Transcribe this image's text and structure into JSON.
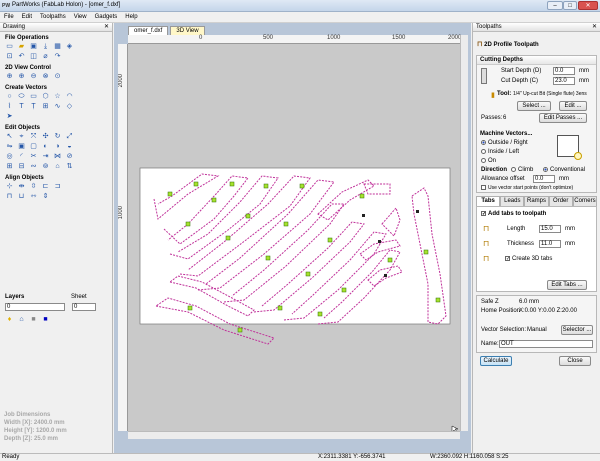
{
  "window": {
    "title": "PartWorks (FabLab Holon) - [omer_f.dxf]",
    "logo": "PW",
    "min": "–",
    "max": "□",
    "close": "✕"
  },
  "menu": [
    "File",
    "Edit",
    "Toolpaths",
    "View",
    "Gadgets",
    "Help"
  ],
  "left_panel": {
    "title": "Drawing",
    "close": "✕",
    "sections": {
      "file_ops": "File Operations",
      "view_ctrl": "2D View Control",
      "create_vectors": "Create Vectors",
      "edit_objects": "Edit Objects",
      "align_objects": "Align Objects"
    },
    "layers_label": "Layers",
    "layer_value": "0",
    "sheet_label": "Sheet",
    "sheet_value": "0",
    "job_dimensions": {
      "heading": "Job Dimensions",
      "width": "Width  [X]: 2400.0 mm",
      "height": "Height [Y]: 1200.0 mm",
      "depth": "Depth  [Z]: 25.0 mm"
    }
  },
  "canvas": {
    "tabs": [
      "omer_f.dxf",
      "3D View"
    ],
    "ruler_top": [
      "0",
      "500",
      "1000",
      "1500",
      "2000"
    ],
    "ruler_left": [
      "2000",
      "1000"
    ]
  },
  "right_panel": {
    "title": "Toolpaths",
    "close": "✕",
    "header": "2D Profile Toolpath",
    "cutting_depths": {
      "title": "Cutting Depths",
      "start_label": "Start Depth (D)",
      "start_value": "0.0",
      "cut_label": "Cut Depth (C)",
      "cut_value": "23.0",
      "unit": "mm"
    },
    "tool": {
      "label": "Tool:",
      "value": "1/4\" Up-cut Bit (Single flute) 3ens",
      "select": "Select ...",
      "edit": "Edit ..."
    },
    "passes": {
      "label": "Passes:",
      "value": "6",
      "button": "Edit Passes ..."
    },
    "machine_vectors": {
      "title": "Machine Vectors...",
      "outside": "Outside / Right",
      "inside": "Inside / Left",
      "on": "On",
      "direction": "Direction",
      "climb": "Climb",
      "conventional": "Conventional",
      "allowance_label": "Allowance offset",
      "allowance_value": "0.0",
      "unit": "mm",
      "use_start": "Use vector start points (don't optimize)"
    },
    "tabs": [
      "Tabs",
      "Leads",
      "Ramps",
      "Order",
      "Corners"
    ],
    "tabs_section": {
      "add": "Add tabs to toolpath",
      "length_label": "Length",
      "length_value": "15.0",
      "thickness_label": "Thickness",
      "thickness_value": "11.0",
      "unit": "mm",
      "create3d": "Create 3D tabs",
      "edit_tabs": "Edit Tabs ..."
    },
    "safe_z_label": "Safe Z",
    "safe_z_value": "6.0 mm",
    "home_label": "Home Position",
    "home_value": "X:0.00 Y:0.00 Z:20.00",
    "vector_selection_label": "Vector Selection:",
    "vector_selection_value": "Manual",
    "selector": "Selector ...",
    "name_label": "Name:",
    "name_value": "OUT",
    "calculate": "Calculate",
    "close_btn": "Close"
  },
  "status": {
    "ready": "Ready",
    "coords": "X:2311.3381 Y:-656.3741",
    "size": "W:2360.092   H:1160.058   S:25"
  }
}
